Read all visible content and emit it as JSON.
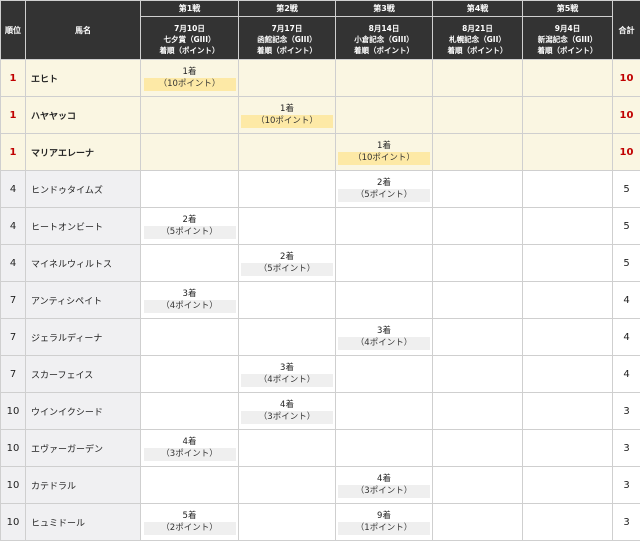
{
  "headers": {
    "rank": "順位",
    "name": "馬名",
    "total": "合計",
    "races": [
      {
        "num": "第1戦",
        "date": "7月10日",
        "race": "七夕賞（GIII）",
        "note": "着順（ポイント）"
      },
      {
        "num": "第2戦",
        "date": "7月17日",
        "race": "函館記念（GIII）",
        "note": "着順（ポイント）"
      },
      {
        "num": "第3戦",
        "date": "8月14日",
        "race": "小倉記念（GIII）",
        "note": "着順（ポイント）"
      },
      {
        "num": "第4戦",
        "date": "8月21日",
        "race": "札幌記念（GII）",
        "note": "着順（ポイント）"
      },
      {
        "num": "第5戦",
        "date": "9月4日",
        "race": "新潟記念（GIII）",
        "note": "着順（ポイント）"
      }
    ]
  },
  "rows": [
    {
      "rank": "1",
      "name": "エヒト",
      "top": true,
      "total": "10",
      "results": [
        {
          "place": "1着",
          "pts": "（10ポイント）"
        },
        null,
        null,
        null,
        null
      ]
    },
    {
      "rank": "1",
      "name": "ハヤヤッコ",
      "top": true,
      "total": "10",
      "results": [
        null,
        {
          "place": "1着",
          "pts": "（10ポイント）"
        },
        null,
        null,
        null
      ]
    },
    {
      "rank": "1",
      "name": "マリアエレーナ",
      "top": true,
      "total": "10",
      "results": [
        null,
        null,
        {
          "place": "1着",
          "pts": "（10ポイント）"
        },
        null,
        null
      ]
    },
    {
      "rank": "4",
      "name": "ヒンドゥタイムズ",
      "top": false,
      "total": "5",
      "results": [
        null,
        null,
        {
          "place": "2着",
          "pts": "（5ポイント）"
        },
        null,
        null
      ]
    },
    {
      "rank": "4",
      "name": "ヒートオンビート",
      "top": false,
      "total": "5",
      "results": [
        {
          "place": "2着",
          "pts": "（5ポイント）"
        },
        null,
        null,
        null,
        null
      ]
    },
    {
      "rank": "4",
      "name": "マイネルウィルトス",
      "top": false,
      "total": "5",
      "results": [
        null,
        {
          "place": "2着",
          "pts": "（5ポイント）"
        },
        null,
        null,
        null
      ]
    },
    {
      "rank": "7",
      "name": "アンティシペイト",
      "top": false,
      "total": "4",
      "results": [
        {
          "place": "3着",
          "pts": "（4ポイント）"
        },
        null,
        null,
        null,
        null
      ]
    },
    {
      "rank": "7",
      "name": "ジェラルディーナ",
      "top": false,
      "total": "4",
      "results": [
        null,
        null,
        {
          "place": "3着",
          "pts": "（4ポイント）"
        },
        null,
        null
      ]
    },
    {
      "rank": "7",
      "name": "スカーフェイス",
      "top": false,
      "total": "4",
      "results": [
        null,
        {
          "place": "3着",
          "pts": "（4ポイント）"
        },
        null,
        null,
        null
      ]
    },
    {
      "rank": "10",
      "name": "ウインイクシード",
      "top": false,
      "total": "3",
      "results": [
        null,
        {
          "place": "4着",
          "pts": "（3ポイント）"
        },
        null,
        null,
        null
      ]
    },
    {
      "rank": "10",
      "name": "エヴァーガーデン",
      "top": false,
      "total": "3",
      "results": [
        {
          "place": "4着",
          "pts": "（3ポイント）"
        },
        null,
        null,
        null,
        null
      ]
    },
    {
      "rank": "10",
      "name": "カテドラル",
      "top": false,
      "total": "3",
      "results": [
        null,
        null,
        {
          "place": "4着",
          "pts": "（3ポイント）"
        },
        null,
        null
      ]
    },
    {
      "rank": "10",
      "name": "ヒュミドール",
      "top": false,
      "total": "3",
      "results": [
        {
          "place": "5着",
          "pts": "（2ポイント）"
        },
        null,
        {
          "place": "9着",
          "pts": "（1ポイント）"
        },
        null,
        null
      ]
    }
  ]
}
